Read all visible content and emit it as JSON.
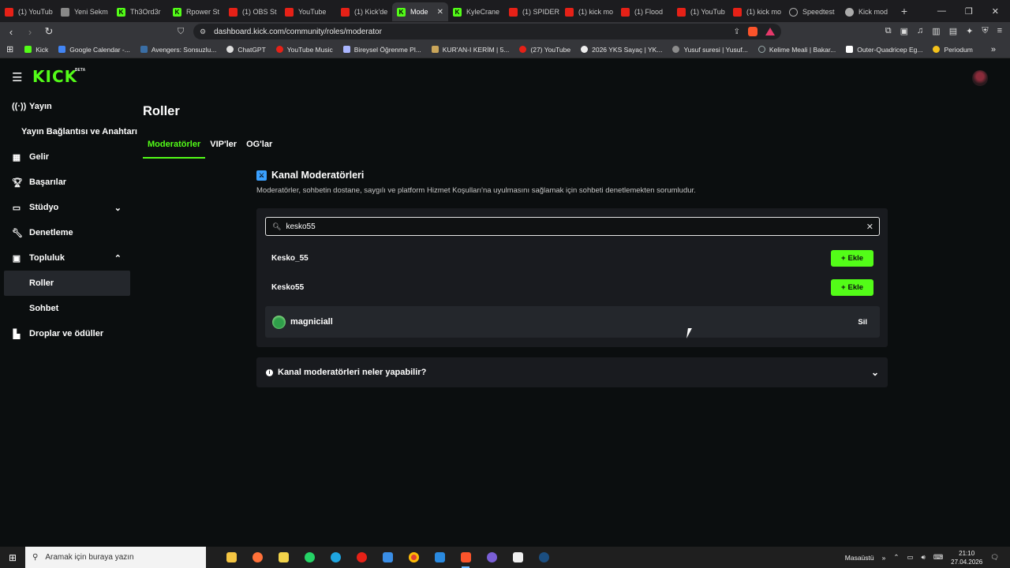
{
  "browser": {
    "tabs": [
      {
        "label": "(1) YouTub",
        "color": "#e62117"
      },
      {
        "label": "Yeni Sekm",
        "color": "#888888"
      },
      {
        "label": "Th3Ord3r",
        "color": "#53fc18"
      },
      {
        "label": "Rpower St",
        "color": "#53fc18"
      },
      {
        "label": "(1) OBS St",
        "color": "#e62117"
      },
      {
        "label": "YouTube",
        "color": "#e62117"
      },
      {
        "label": "(1) Kick'de",
        "color": "#e62117"
      },
      {
        "label": "Mode",
        "color": "#53fc18",
        "active": true
      },
      {
        "label": "KyleCrane",
        "color": "#53fc18"
      },
      {
        "label": "(1) SPIDER",
        "color": "#e62117"
      },
      {
        "label": "(1) kick mo",
        "color": "#e62117"
      },
      {
        "label": "(1) Flood",
        "color": "#e62117"
      },
      {
        "label": "(1) YouTub",
        "color": "#e62117"
      },
      {
        "label": "(1) kick mo",
        "color": "#e62117"
      },
      {
        "label": "Speedtest",
        "color": "#aaaaaa"
      },
      {
        "label": "Kick mod",
        "color": "#aaaaaa"
      }
    ],
    "new_tab": "+",
    "url": "dashboard.kick.com/community/roles/moderator",
    "bookmarks": [
      {
        "label": "Kick",
        "color": "#53fc18"
      },
      {
        "label": "Google Calendar -...",
        "color": "#4285f4"
      },
      {
        "label": "Avengers: Sonsuzlu...",
        "color": "#3a6ea5"
      },
      {
        "label": "ChatGPT",
        "color": "#dddddd"
      },
      {
        "label": "YouTube Music",
        "color": "#e62117"
      },
      {
        "label": "Bireysel Öğrenme Pl...",
        "color": "#aab6ff"
      },
      {
        "label": "KUR'AN-I KERİM | 5...",
        "color": "#c9a55a"
      },
      {
        "label": "(27) YouTube",
        "color": "#e62117"
      },
      {
        "label": "2026 YKS Sayaç | YK...",
        "color": "#eeeeee"
      },
      {
        "label": "Yusuf suresi | Yusuf...",
        "color": "#8c8c8c"
      },
      {
        "label": "Kelime Meali | Bakar...",
        "color": "#9aa"
      },
      {
        "label": "Outer-Quadricep Eg...",
        "color": "#ffffff"
      },
      {
        "label": "Periodum",
        "color": "#f4c21b"
      }
    ]
  },
  "app": {
    "logo": "KICK",
    "logo_badge": "BETA",
    "brand_color": "#53fc18"
  },
  "sidebar": {
    "items": [
      {
        "label": "Yayın",
        "icon": "broadcast-icon"
      },
      {
        "label": "Yayın Bağlantısı ve Anahtarı"
      },
      {
        "label": "Gelir",
        "icon": "chart-icon"
      },
      {
        "label": "Başarılar",
        "icon": "trophy-icon"
      },
      {
        "label": "Stüdyo",
        "icon": "studio-icon"
      },
      {
        "label": "Denetleme",
        "icon": "wrench-icon"
      },
      {
        "label": "Topluluk",
        "icon": "community-icon"
      },
      {
        "label": "Roller"
      },
      {
        "label": "Sohbet"
      },
      {
        "label": "Droplar ve ödüller",
        "icon": "drops-icon"
      }
    ]
  },
  "page": {
    "title": "Roller",
    "tabs": [
      "Moderatörler",
      "VIP'ler",
      "OG'lar"
    ],
    "section_title": "Kanal Moderatörleri",
    "section_desc": "Moderatörler, sohbetin dostane, saygılı ve platform Hizmet Koşulları'na uyulmasını sağlamak için sohbeti denetlemekten sorumludur.",
    "search_value": "kesko55",
    "results": [
      {
        "username": "Kesko_55",
        "action": "Ekle"
      },
      {
        "username": "Kesko55",
        "action": "Ekle"
      }
    ],
    "moderators": [
      {
        "username": "magniciall",
        "action": "Sil"
      }
    ],
    "faq": "Kanal moderatörleri neler yapabilir?"
  },
  "taskbar": {
    "search_placeholder": "Aramak için buraya yazın",
    "desktop_label": "Masaüstü",
    "time": "21:10",
    "date": "27.04.2026"
  }
}
